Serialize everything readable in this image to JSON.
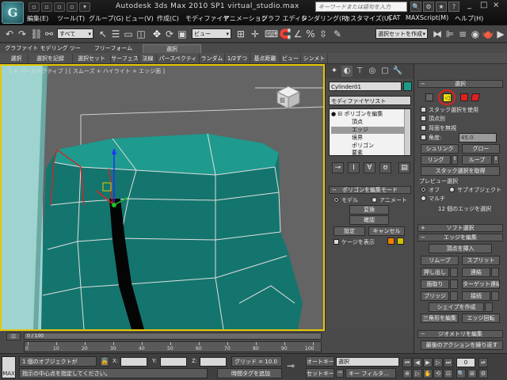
{
  "titlebar": {
    "app_logo": "G",
    "title": "Autodesk 3ds Max  2010 SP1    virtual_studio.max",
    "search_placeholder": "キーワードまたは語句を入力",
    "qa_buttons": [
      "▫",
      "▫",
      "▫",
      "▫",
      "▾"
    ],
    "right_icons": [
      "🔍",
      "⚙",
      "★",
      "?"
    ]
  },
  "menu": {
    "items": [
      "編集(E)",
      "ツール(T)",
      "グループ(G)",
      "ビュー(V)",
      "作成(C)",
      "モディファイヤ",
      "アニメーション",
      "グラフ エディタ",
      "レンダリング(R)",
      "カスタマイズ(U)",
      "CAT",
      "MAXScript(M)",
      "ヘルプ(H)"
    ]
  },
  "toolbar": {
    "selection_filter": "すべて",
    "ref_coord": "ビュー",
    "named_selection": "選択セットを作成"
  },
  "ribbon": {
    "tabs": [
      "グラファイト モデリング ツール",
      "フリーフォーム",
      "選択"
    ],
    "panel_buttons": [
      "選択",
      "選択を記録",
      "選択セット",
      "サーフェス",
      "法線",
      "パースペクティブ",
      "ランダム",
      "1/2ずつ",
      "基点距離",
      "ビュー",
      "シンメトリ"
    ]
  },
  "viewport": {
    "label": "[ + パースペクティブ ] [ スムーズ + ハイライト + エッジ面 ]",
    "viewcube_label": "前"
  },
  "command_panel": {
    "object_name": "Cylinder01",
    "object_color": "#1b9a8a",
    "modifier_list": "モディファイヤリスト",
    "stack": [
      "ポリゴンを編集",
      "頂点",
      "エッジ",
      "境界",
      "ポリゴン",
      "要素"
    ],
    "edit_poly_mode": {
      "title": "ポリゴンを編集モード",
      "model": "モデル",
      "animate": "アニメート",
      "commit": "変換",
      "confirm": "確認",
      "settings": "設定",
      "cancel": "キャンセル",
      "show_cage": "ケージを表示"
    }
  },
  "right_panel": {
    "selection": {
      "title": "選択",
      "by_vertex": "スタック選択を使用",
      "by_angle_vertex": "頂点別",
      "ignore_backfacing": "背面を無視",
      "angle_label": "角度:",
      "angle_value": "45.0",
      "shrink": "シュリンク",
      "grow": "グロー",
      "ring": "リング",
      "loop": "ループ",
      "get_stack": "スタック選択を取得",
      "preview": "プレビュー選択",
      "off": "オフ",
      "subobj": "サブオブジェクト",
      "multi": "マルチ",
      "status": "12 個のエッジを選択"
    },
    "soft_selection": "ソフト選択",
    "edit_edges": {
      "title": "エッジを編集",
      "insert_vertex": "頂点を挿入",
      "remove": "リムーブ",
      "split": "スプリット",
      "extrude": "押し出し",
      "weld": "連結",
      "chamfer": "面取り",
      "target_weld": "ターゲット連結",
      "bridge": "ブリッジ",
      "connect": "接続",
      "create_shape": "シェイプを作成",
      "edit_tri": "三角形を編集",
      "turn": "エッジ回転"
    },
    "edit_geometry": {
      "title": "ジオメトリを編集",
      "repeat_last": "最後のアクションを繰り返す"
    }
  },
  "timeline": {
    "slider": "0 / 100",
    "ticks": [
      "0",
      "10",
      "20",
      "30",
      "40",
      "50",
      "60",
      "70",
      "80",
      "90",
      "100"
    ]
  },
  "status": {
    "max_label": "MAX",
    "selected": "1 個のオブジェクトが",
    "prompt": "指示の中心点を指定してください。",
    "x_label": "X:",
    "y_label": "Y:",
    "z_label": "Z:",
    "grid": "グリッド = 10.0",
    "add_time_tag": "時間タグを追加",
    "auto_key": "オートキー",
    "set_key": "セットキー",
    "key_filter_label": "キー フィルタ...",
    "selection_dropdown": "選択"
  },
  "colors": {
    "viewport_border": "#e6c700",
    "mesh_teal": "#14756e",
    "highlight_red": "#e02020"
  }
}
